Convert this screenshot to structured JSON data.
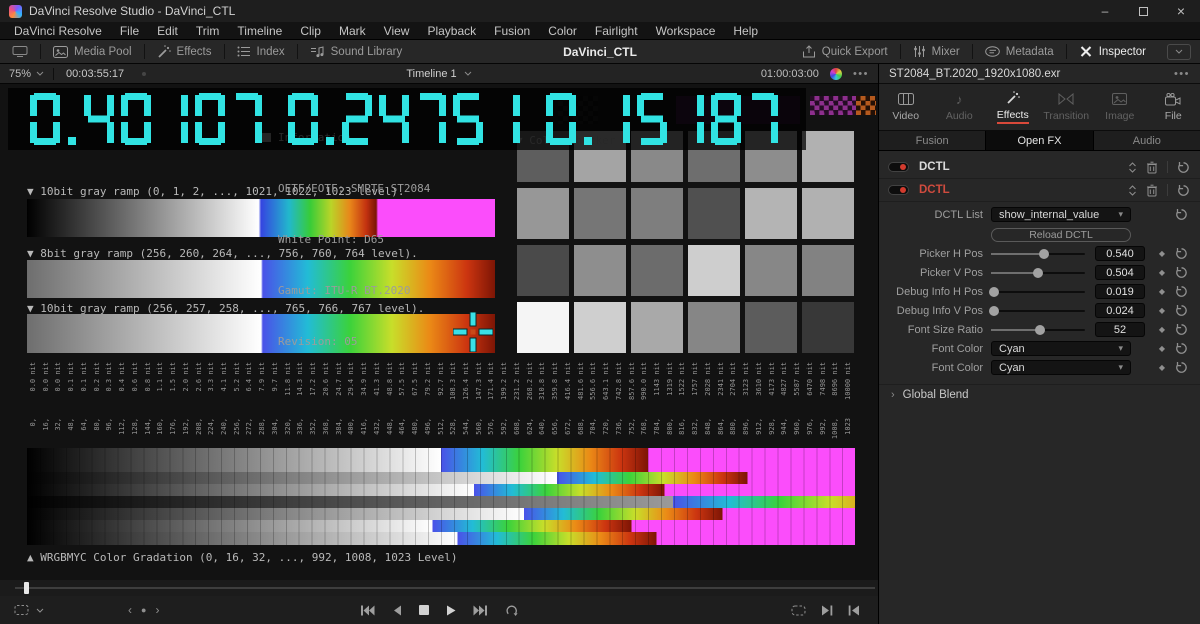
{
  "window": {
    "title": "DaVinci Resolve Studio - DaVinci_CTL"
  },
  "menu": {
    "items": [
      "DaVinci Resolve",
      "File",
      "Edit",
      "Trim",
      "Timeline",
      "Clip",
      "Mark",
      "View",
      "Playback",
      "Fusion",
      "Color",
      "Fairlight",
      "Workspace",
      "Help"
    ]
  },
  "toolbar": {
    "media_pool": "Media Pool",
    "effects": "Effects",
    "index": "Index",
    "sound_library": "Sound Library",
    "project_title": "DaVinci_CTL",
    "quick_export": "Quick Export",
    "mixer": "Mixer",
    "metadata": "Metadata",
    "inspector": "Inspector"
  },
  "viewer_header": {
    "zoom_level": "75%",
    "timecode_in": "00:03:55:17",
    "timeline_name": "Timeline 1",
    "timecode_playhead": "01:00:03:00",
    "menu_dots": "•••"
  },
  "viewer": {
    "digits": "0.40107 0.24751 0.15187",
    "digit_color": "#31e3e3",
    "info": {
      "title": "Information",
      "lines": [
        "OETF/EOTF: SMPTE ST2084",
        "White Point: D65",
        "Gamut: ITU-R BT.2020",
        "Revision: 05"
      ]
    },
    "color_checker_label": "▼ Color Checker",
    "checker_cells": [
      "#5e5e5e",
      "#a4a4a4",
      "#898989",
      "#6e6e6e",
      "#8d8d8d",
      "#b1b1b1",
      "#979797",
      "#767676",
      "#7e7e7e",
      "#505050",
      "#b4b4b4",
      "#b1b1b1",
      "#4a4a4a",
      "#8e8e8e",
      "#6c6c6c",
      "#cecece",
      "#878787",
      "#828282",
      "#f5f5f5",
      "#cfcfcf",
      "#a9a9a9",
      "#868686",
      "#5c5c5c",
      "#383838"
    ],
    "ramps": [
      {
        "label": "▼ 10bit gray ramp (0, 1, 2, ..., 1021, 1022, 1023 level)."
      },
      {
        "label": "▼ 8bit gray ramp (256, 260, 264, ..., 756, 760, 764 level)."
      },
      {
        "label": "▼ 10bit gray ramp (256, 257, 258, ..., 765, 766, 767 level)."
      }
    ],
    "axis": {
      "unit": "nit",
      "nits": [
        "0.0",
        "0.0",
        "0.0",
        "0.1",
        "0.1",
        "0.2",
        "0.3",
        "0.4",
        "0.6",
        "0.8",
        "1.1",
        "1.5",
        "2.0",
        "2.6",
        "3.3",
        "4.1",
        "5.2",
        "6.4",
        "7.9",
        "9.7",
        "11.8",
        "14.3",
        "17.2",
        "20.6",
        "24.7",
        "29.4",
        "34.9",
        "41.3",
        "48.8",
        "57.5",
        "67.5",
        "79.2",
        "92.7",
        "108.3",
        "126.4",
        "147.3",
        "171.4",
        "199.2",
        "231.2",
        "268.2",
        "310.8",
        "359.8",
        "416.4",
        "481.6",
        "556.6",
        "643.1",
        "742.8",
        "857.6",
        "990.0",
        "1143",
        "1319",
        "1522",
        "1757",
        "2028",
        "2341",
        "2704",
        "3123",
        "3610",
        "4173",
        "4827",
        "5587",
        "6470",
        "7498",
        "8696",
        "10000"
      ],
      "codes": [
        "0,",
        "16,",
        "32,",
        "48,",
        "64,",
        "80,",
        "96,",
        "112,",
        "128,",
        "144,",
        "160,",
        "176,",
        "192,",
        "208,",
        "224,",
        "240,",
        "256,",
        "272,",
        "288,",
        "304,",
        "320,",
        "336,",
        "352,",
        "368,",
        "384,",
        "400,",
        "416,",
        "432,",
        "448,",
        "464,",
        "480,",
        "496,",
        "512,",
        "528,",
        "544,",
        "560,",
        "576,",
        "592,",
        "608,",
        "624,",
        "640,",
        "656,",
        "672,",
        "688,",
        "704,",
        "720,",
        "736,",
        "752,",
        "768,",
        "784,",
        "800,",
        "816,",
        "832,",
        "848,",
        "864,",
        "880,",
        "896,",
        "912,",
        "928,",
        "944,",
        "960,",
        "976,",
        "992,",
        "1008,",
        "1023"
      ]
    },
    "gradation": {
      "label": "▲ WRGBMYC Color Gradation (0, 16, 32, ..., 992, 1008, 1023 Level)",
      "magenta": "#fb4dfb",
      "rows": [
        {
          "height": 24,
          "white_pct": 50,
          "rainbow_end_pct": 75,
          "tail": "magenta",
          "gray_top": "#ffffff"
        },
        {
          "height": 12,
          "white_pct": 64,
          "rainbow_end_pct": 87,
          "tail": "magenta",
          "gray_top": "#ffffff"
        },
        {
          "height": 12,
          "white_pct": 54,
          "rainbow_end_pct": 77,
          "tail": "magenta",
          "gray_top": "#ffffff"
        },
        {
          "height": 12,
          "white_pct": 78,
          "rainbow_end_pct": 112,
          "tail": "none",
          "gray_top": "#9a9a9a"
        },
        {
          "height": 12,
          "white_pct": 60,
          "rainbow_end_pct": 84,
          "tail": "magenta",
          "gray_top": "#ffffff"
        },
        {
          "height": 12,
          "white_pct": 49,
          "rainbow_end_pct": 73,
          "tail": "magenta",
          "gray_top": "#ffffff"
        },
        {
          "height": 13,
          "white_pct": 52,
          "rainbow_end_pct": 76,
          "tail": "magenta",
          "gray_top": "#ffffff"
        }
      ]
    }
  },
  "inspector": {
    "clip_name": "ST2084_BT.2020_1920x1080.exr",
    "menu_dots": "•••",
    "tabs": [
      {
        "label": "Video",
        "dim": false,
        "active": false
      },
      {
        "label": "Audio",
        "dim": true,
        "active": false
      },
      {
        "label": "Effects",
        "dim": false,
        "active": true
      },
      {
        "label": "Transition",
        "dim": true,
        "active": false
      },
      {
        "label": "Image",
        "dim": true,
        "active": false
      },
      {
        "label": "File",
        "dim": false,
        "active": false
      }
    ],
    "subtabs": [
      {
        "label": "Fusion",
        "active": false
      },
      {
        "label": "Open FX",
        "active": true
      },
      {
        "label": "Audio",
        "active": false
      }
    ],
    "effects": [
      {
        "name": "DCTL",
        "selected": false
      },
      {
        "name": "DCTL",
        "selected": true
      }
    ],
    "dctl_list": {
      "label": "DCTL List",
      "value": "show_internal_value"
    },
    "reload_button_label": "Reload DCTL",
    "sliders": [
      {
        "label": "Picker H Pos",
        "value": "0.540",
        "pct": 56
      },
      {
        "label": "Picker V Pos",
        "value": "0.504",
        "pct": 50
      },
      {
        "label": "Debug Info H Pos",
        "value": "0.019",
        "pct": 3
      },
      {
        "label": "Debug Info V Pos",
        "value": "0.024",
        "pct": 3
      },
      {
        "label": "Font Size Ratio",
        "value": "52",
        "pct": 52
      }
    ],
    "color_rows": [
      {
        "label": "Font Color",
        "value": "Cyan"
      },
      {
        "label": "Font Color",
        "value": "Cyan"
      }
    ],
    "global_blend_label": "Global Blend",
    "accent_red": "#d9493a"
  }
}
